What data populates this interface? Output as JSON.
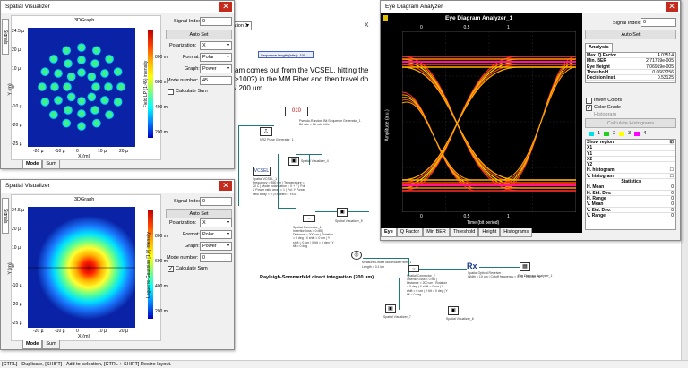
{
  "app": {
    "status_bar": "[CTRL] - Duplicate, [SHIFT] - Add to selection, [CTRL + SHIFT] Resize layout.",
    "toolbar_dropdown": "ation 1",
    "toolbar_close": "x",
    "seq_length": "Sequence length (bits) : 100",
    "desc_line1": "am comes out from the VCSEL, hitting the",
    "desc_line2": ">100?) in the MM Fiber and then travel do",
    "desc_line3": "/ 200 um.",
    "canvas_caption": "Rayleigh-Sommerfeld direct integration (200 um)",
    "components": [
      {
        "name": "Pseudo-Random Bit Sequence Generator_1",
        "detail": "Bit rate = Bit rate  bit/s"
      },
      {
        "name": "NRZ Pulse Generator_1",
        "detail": ""
      },
      {
        "name": "Spatial VCSEL_1",
        "detail": "Frequency = 850 nm | Temperature = 20 C | Mode polarization = X + Y | Pol. X Power ratio array = 1 | Pol. Y Power ratio array = 0 | Enabled = YES"
      },
      {
        "name": "Spatial Visualizer_4",
        "detail": ""
      },
      {
        "name": "Spatial Connector_1",
        "detail": "Insertion loss = 0  dB | Distance = 200  um | Rotation = 0  deg | X shift = 0  um | Y shift = 0  um | X tilt = 0  deg | Y tilt = 0  deg"
      },
      {
        "name": "Spatial Visualizer_5",
        "detail": ""
      },
      {
        "name": "Measured-Index Multimode Fiber_1",
        "detail": "Length = 0.1  km"
      },
      {
        "name": "Spatial Connector_2",
        "detail": "Insertion loss = 0  dB | Distance = 200  um | Rotation = 0  deg | X shift = 0  um | Y shift = 0  um | X tilt = 0  deg | Y tilt = 0  deg"
      },
      {
        "name": "Spatial Optical Receiver",
        "detail": "Width = 10  um | Cutoff frequency = 0.75 * Bit rate  Hz"
      },
      {
        "name": "Eye Diagram Analyzer_1",
        "detail": ""
      },
      {
        "name": "Spatial Visualizer_7",
        "detail": ""
      },
      {
        "name": "Spatial Visualizer_6",
        "detail": ""
      }
    ],
    "rx_label": "Rx"
  },
  "sv1": {
    "title": "Spatial Visualizer",
    "graph_title": "3DGraph",
    "side_tab": "Signals",
    "signal_index_label": "Signal Index:",
    "signal_index": "0",
    "auto_set": "Auto Set",
    "polarization_label": "Polarization:",
    "polarization": "X",
    "format_label": "Format:",
    "format": "Polar",
    "graph_label": "Graph:",
    "graph": "Power",
    "mode_number_label": "Mode number:",
    "mode_number": "45",
    "calc_sum_label": "Calculate Sum",
    "calc_sum_checked": false,
    "y_axis": "Y (m)",
    "x_axis": "X (m)",
    "intensity_label": "Field LP (1:45) intensity",
    "yticks": [
      "24.5 µ",
      "20 µ",
      "10 µ",
      "0",
      "-10 µ",
      "-20 µ",
      "-25 µ"
    ],
    "xticks": [
      "-20 µ",
      "-10 µ",
      "0",
      "10 µ",
      "20 µ"
    ],
    "cticks": [
      "800 m",
      "600 m",
      "400 m",
      "200 m"
    ],
    "tabs": [
      "Mode",
      "Sum"
    ]
  },
  "sv2": {
    "title": "Spatial Visualizer",
    "graph_title": "3DGraph",
    "side_tab": "Signals",
    "signal_index_label": "Signal Index:",
    "signal_index": "0",
    "auto_set": "Auto Set",
    "polarization_label": "Polarization:",
    "polarization": "X",
    "format_label": "Format:",
    "format": "Polar",
    "graph_label": "Graph:",
    "graph": "Power",
    "mode_number_label": "Mode number:",
    "mode_number": "0",
    "calc_sum_label": "Calculate Sum",
    "calc_sum_checked": true,
    "y_axis": "Y (m)",
    "x_axis": "X (m)",
    "intensity_label": "Laguerre-Gaussian [1,0] intensity",
    "yticks": [
      "24.5 µ",
      "20 µ",
      "10 µ",
      "0",
      "-10 µ",
      "-20 µ",
      "-25 µ"
    ],
    "xticks": [
      "-20 µ",
      "-10 µ",
      "0",
      "10 µ",
      "20 µ"
    ],
    "cticks": [
      "800 m",
      "600 m",
      "400 m",
      "200 m"
    ],
    "tabs": [
      "Mode",
      "Sum"
    ]
  },
  "eye": {
    "title": "Eye Diagram Analyzer",
    "graph_title": "Eye Diagram Analyzer_1",
    "signal_index_label": "Signal Index:",
    "signal_index": "0",
    "auto_set": "Auto Set",
    "analysis_tab": "Analysis",
    "analysis": [
      {
        "k": "Max. Q Factor",
        "v": "4.03514"
      },
      {
        "k": "Min. BER",
        "v": "2.71769e-005"
      },
      {
        "k": "Eye Height",
        "v": "7.06919e-005"
      },
      {
        "k": "Threshold",
        "v": "0.0663256"
      },
      {
        "k": "Decision Inst.",
        "v": "0.53125"
      }
    ],
    "invert_colors": "Invert Colors",
    "color_grade": "Color Grade",
    "histogram": "Histogram",
    "calc_histograms": "Calculate Histograms",
    "colors_nums": [
      "1",
      "2",
      "3",
      "4"
    ],
    "show_region": "Show region",
    "region_rows": [
      "X1",
      "Y1",
      "X2",
      "Y2",
      "H. histogram",
      "V. histogram"
    ],
    "statistics_label": "Statistics",
    "stat_rows": [
      {
        "k": "H. Mean",
        "v": "0"
      },
      {
        "k": "H. Std. Dev.",
        "v": "0"
      },
      {
        "k": "H. Range",
        "v": "0"
      },
      {
        "k": "V. Mean",
        "v": "0"
      },
      {
        "k": "V. Std. Dev.",
        "v": "0"
      },
      {
        "k": "V. Range",
        "v": "0"
      }
    ],
    "x_axis": "Time (bit period)",
    "y_axis": "Amplitude (a.u.)",
    "xticks": [
      "0",
      "0.5",
      "1"
    ],
    "top_ticks": [
      "0",
      "0.5",
      "1"
    ],
    "tabs": [
      "Eye",
      "Q Factor",
      "Min BER",
      "Threshold",
      "Height",
      "Histograms"
    ]
  }
}
